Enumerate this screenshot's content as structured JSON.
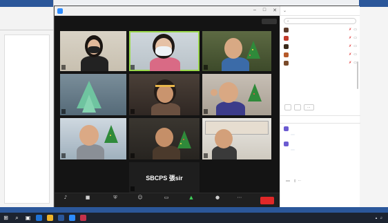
{
  "zoom": {
    "title": "",
    "view_label": ""
  },
  "tiles": [
    {
      "label": "",
      "active": false
    },
    {
      "label": "",
      "active": true
    },
    {
      "label": "",
      "active": false
    },
    {
      "label": "",
      "active": false
    },
    {
      "label": "",
      "active": false
    },
    {
      "label": "",
      "active": false
    },
    {
      "label": "",
      "active": false
    },
    {
      "label": "",
      "active": false
    },
    {
      "label": "",
      "active": false
    },
    {
      "label": "",
      "name_plate": "SBCPS 張sir"
    }
  ],
  "toolbar": {
    "items": [
      {
        "icon": "microphone-icon",
        "label": ""
      },
      {
        "icon": "video-camera-icon",
        "label": ""
      },
      {
        "icon": "shield-icon",
        "label": ""
      },
      {
        "icon": "participants-icon",
        "label": "",
        "count": ""
      },
      {
        "icon": "chat-icon",
        "label": ""
      },
      {
        "icon": "share-screen-icon",
        "label": "",
        "color": "#3fcf5a"
      },
      {
        "icon": "record-icon",
        "label": ""
      },
      {
        "icon": "more-icon",
        "label": ""
      }
    ],
    "end_label": ""
  },
  "participants_panel": {
    "title": "",
    "search_placeholder": "",
    "participants": [
      {
        "name": "",
        "avatar_color": "#5a3a2a",
        "mic_muted": true
      },
      {
        "name": "",
        "avatar_color": "#c23a2a",
        "mic_muted": true
      },
      {
        "name": "",
        "avatar_color": "#3a2a1a",
        "mic_muted": true
      },
      {
        "name": "",
        "avatar_color": "#b65a2a",
        "mic_muted": true
      },
      {
        "name": "",
        "avatar_color": "#7a4a2a",
        "mic_muted": true
      }
    ],
    "buttons": [
      "",
      ""
    ]
  },
  "chat_panel": {
    "title": "",
    "messages": [
      {
        "meta": "",
        "meta_private": "",
        "text": ""
      },
      {
        "meta": "",
        "meta_private": "",
        "text": ""
      }
    ],
    "file_hint": "",
    "to_label": "",
    "to_value": "",
    "to_private": "",
    "input_placeholder": ""
  },
  "statusbar": {
    "left_text": "",
    "zoom": ""
  },
  "taskbar": {
    "time": ""
  },
  "colors": {
    "zoom_blue": "#2d8cff",
    "end_red": "#e02828",
    "active_speaker": "#9ad84a",
    "muted_red": "#e03030",
    "word_blue": "#2b579a"
  }
}
